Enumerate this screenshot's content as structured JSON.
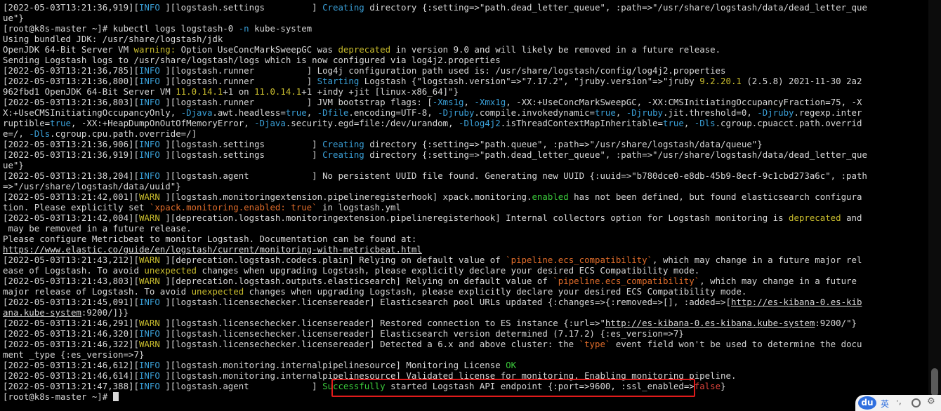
{
  "terminal": {
    "lines": [
      [
        {
          "t": "[2022-05-03T13:21:36,919]["
        },
        {
          "t": "INFO ",
          "c": "cyan"
        },
        {
          "t": "][logstash.settings         ] "
        },
        {
          "t": "Creating",
          "c": "cyan"
        },
        {
          "t": " directory {:setting=>\"path.dead_letter_queue\", :path=>\"/usr/share/logstash/data/dead_letter_que"
        }
      ],
      [
        {
          "t": "ue\"}"
        }
      ],
      [
        {
          "t": "[root@k8s-master ~]# kubectl logs logstash-0 "
        },
        {
          "t": "-n",
          "c": "cyan"
        },
        {
          "t": " kube-system"
        }
      ],
      [
        {
          "t": "Using bundled JDK: /usr/share/logstash/jdk"
        }
      ],
      [
        {
          "t": "OpenJDK 64-Bit Server VM "
        },
        {
          "t": "warning:",
          "c": "yellow"
        },
        {
          "t": " Option UseConcMarkSweepGC was "
        },
        {
          "t": "deprecated",
          "c": "yellow"
        },
        {
          "t": " in version 9.0 and will likely be removed in a future release."
        }
      ],
      [
        {
          "t": "Sending Logstash logs to /usr/share/logstash/logs which is now configured via log4j2.properties"
        }
      ],
      [
        {
          "t": "[2022-05-03T13:21:36,785]["
        },
        {
          "t": "INFO ",
          "c": "cyan"
        },
        {
          "t": "][logstash.runner          ] Log4j configuration path used is: /usr/share/logstash/config/log4j2.properties"
        }
      ],
      [
        {
          "t": "[2022-05-03T13:21:36,800]["
        },
        {
          "t": "INFO ",
          "c": "cyan"
        },
        {
          "t": "][logstash.runner          ] "
        },
        {
          "t": "Starting",
          "c": "cyan"
        },
        {
          "t": " Logstash {\"logstash.version\"=>\"7.17.2\", \"jruby.version\"=>\"jruby "
        },
        {
          "t": "9.2.20.1",
          "c": "yellow"
        },
        {
          "t": " (2.5.8) 2021-11-30 2a2"
        }
      ],
      [
        {
          "t": "962fbd1 OpenJDK 64-Bit Server VM "
        },
        {
          "t": "11.0.14.1",
          "c": "yellow"
        },
        {
          "t": "+1 on "
        },
        {
          "t": "11.0.14.1",
          "c": "yellow"
        },
        {
          "t": "+1 +indy +jit [linux-x86_64]\"}"
        }
      ],
      [
        {
          "t": "[2022-05-03T13:21:36,803]["
        },
        {
          "t": "INFO ",
          "c": "cyan"
        },
        {
          "t": "][logstash.runner          ] JVM bootstrap flags: ["
        },
        {
          "t": "-Xms1g",
          "c": "cyan"
        },
        {
          "t": ", "
        },
        {
          "t": "-Xmx1g",
          "c": "cyan"
        },
        {
          "t": ", -XX:+UseConcMarkSweepGC, -XX:CMSInitiatingOccupancyFraction=75, -X"
        }
      ],
      [
        {
          "t": "X:+UseCMSInitiatingOccupancyOnly, "
        },
        {
          "t": "-Djava",
          "c": "cyan"
        },
        {
          "t": ".awt.headless="
        },
        {
          "t": "true",
          "c": "cyan"
        },
        {
          "t": ", "
        },
        {
          "t": "-Dfile",
          "c": "cyan"
        },
        {
          "t": ".encoding=UTF-8, "
        },
        {
          "t": "-Djruby",
          "c": "cyan"
        },
        {
          "t": ".compile.invokedynamic="
        },
        {
          "t": "true",
          "c": "cyan"
        },
        {
          "t": ", "
        },
        {
          "t": "-Djruby",
          "c": "cyan"
        },
        {
          "t": ".jit.threshold=0, "
        },
        {
          "t": "-Djruby",
          "c": "cyan"
        },
        {
          "t": ".regexp.inter"
        }
      ],
      [
        {
          "t": "ruptible="
        },
        {
          "t": "true",
          "c": "cyan"
        },
        {
          "t": ", -XX:+HeapDumpOnOutOfMemoryError, "
        },
        {
          "t": "-Djava",
          "c": "cyan"
        },
        {
          "t": ".security.egd=file:/dev/urandom, "
        },
        {
          "t": "-Dlog4j2",
          "c": "cyan"
        },
        {
          "t": ".isThreadContextMapInheritable="
        },
        {
          "t": "true",
          "c": "cyan"
        },
        {
          "t": ", "
        },
        {
          "t": "-Dls",
          "c": "cyan"
        },
        {
          "t": ".cgroup.cpuacct.path.overrid"
        }
      ],
      [
        {
          "t": "e=/, "
        },
        {
          "t": "-Dls",
          "c": "cyan"
        },
        {
          "t": ".cgroup.cpu.path.override=/]"
        }
      ],
      [
        {
          "t": "[2022-05-03T13:21:36,906]["
        },
        {
          "t": "INFO ",
          "c": "cyan"
        },
        {
          "t": "][logstash.settings         ] "
        },
        {
          "t": "Creating",
          "c": "cyan"
        },
        {
          "t": " directory {:setting=>\"path.queue\", :path=>\"/usr/share/logstash/data/queue\"}"
        }
      ],
      [
        {
          "t": "[2022-05-03T13:21:36,919]["
        },
        {
          "t": "INFO ",
          "c": "cyan"
        },
        {
          "t": "][logstash.settings         ] "
        },
        {
          "t": "Creating",
          "c": "cyan"
        },
        {
          "t": " directory {:setting=>\"path.dead_letter_queue\", :path=>\"/usr/share/logstash/data/dead_letter_que"
        }
      ],
      [
        {
          "t": "ue\"}"
        }
      ],
      [
        {
          "t": "[2022-05-03T13:21:38,204]["
        },
        {
          "t": "INFO ",
          "c": "cyan"
        },
        {
          "t": "][logstash.agent            ] No persistent UUID file found. Generating new UUID {:uuid=>\"b780dce0-e8db-45b9-8ecf-9c1cbd273a6c\", :path"
        }
      ],
      [
        {
          "t": "=>\"/usr/share/logstash/data/uuid\"}"
        }
      ],
      [
        {
          "t": "[2022-05-03T13:21:42,001]["
        },
        {
          "t": "WARN ",
          "c": "yellow"
        },
        {
          "t": "][logstash.monitoringextension.pipelineregisterhook] xpack.monitoring."
        },
        {
          "t": "enabled",
          "c": "green"
        },
        {
          "t": " has not been defined, but found elasticsearch configura"
        }
      ],
      [
        {
          "t": "tion. Please explicitly set "
        },
        {
          "t": "`xpack.monitoring.enabled: true`",
          "c": "orange"
        },
        {
          "t": " in logstash.yml"
        }
      ],
      [
        {
          "t": "[2022-05-03T13:21:42,004]["
        },
        {
          "t": "WARN ",
          "c": "yellow"
        },
        {
          "t": "][deprecation.logstash.monitoringextension.pipelineregisterhook] Internal collectors option for Logstash monitoring is "
        },
        {
          "t": "deprecated",
          "c": "yellow"
        },
        {
          "t": " and"
        }
      ],
      [
        {
          "t": " may be removed in a future release."
        }
      ],
      [
        {
          "t": "Please configure Metricbeat to monitor Logstash. Documentation can be found at:"
        }
      ],
      [
        {
          "t": "https://www.elastic.co/guide/en/logstash/current/monitoring-with-metricbeat.html",
          "u": true
        }
      ],
      [
        {
          "t": "[2022-05-03T13:21:43,212]["
        },
        {
          "t": "WARN ",
          "c": "yellow"
        },
        {
          "t": "][deprecation.logstash.codecs.plain] Relying on default value of "
        },
        {
          "t": "`pipeline.ecs_compatibility`",
          "c": "orange"
        },
        {
          "t": ", which may change in a future major rel"
        }
      ],
      [
        {
          "t": "ease of Logstash. To avoid "
        },
        {
          "t": "unexpected",
          "c": "yellow"
        },
        {
          "t": " changes when upgrading Logstash, please explicitly declare your desired ECS Compatibility mode."
        }
      ],
      [
        {
          "t": "[2022-05-03T13:21:43,803]["
        },
        {
          "t": "WARN ",
          "c": "yellow"
        },
        {
          "t": "][deprecation.logstash.outputs.elasticsearch] Relying on default value of "
        },
        {
          "t": "`pipeline.ecs_compatibility`",
          "c": "orange"
        },
        {
          "t": ", which may change in a future"
        }
      ],
      [
        {
          "t": "major release of Logstash. To avoid "
        },
        {
          "t": "unexpected",
          "c": "yellow"
        },
        {
          "t": " changes when upgrading Logstash, please explicitly declare your desired ECS Compatibility mode."
        }
      ],
      [
        {
          "t": "[2022-05-03T13:21:45,091]["
        },
        {
          "t": "INFO ",
          "c": "cyan"
        },
        {
          "t": "][logstash.licensechecker.licensereader] Elasticsearch pool URLs updated {:changes=>{:removed=>[], :added=>["
        },
        {
          "t": "http://es-kibana-0.es-kib",
          "u": true
        }
      ],
      [
        {
          "t": "ana.kube-system",
          "u": true
        },
        {
          "t": ":9200/]}}"
        }
      ],
      [
        {
          "t": "[2022-05-03T13:21:46,291]["
        },
        {
          "t": "WARN ",
          "c": "yellow"
        },
        {
          "t": "][logstash.licensechecker.licensereader] Restored connection to ES instance {:url=>\""
        },
        {
          "t": "http://es-kibana-0.es-kibana.kube-system",
          "u": true
        },
        {
          "t": ":9200/\"}"
        }
      ],
      [
        {
          "t": "[2022-05-03T13:21:46,320]["
        },
        {
          "t": "INFO ",
          "c": "cyan"
        },
        {
          "t": "][logstash.licensechecker.licensereader] Elasticsearch version determined (7.17.2) {:es_version=>7}"
        }
      ],
      [
        {
          "t": "[2022-05-03T13:21:46,322]["
        },
        {
          "t": "WARN ",
          "c": "yellow"
        },
        {
          "t": "][logstash.licensechecker.licensereader] Detected a 6.x and above cluster: the "
        },
        {
          "t": "`type`",
          "c": "orange"
        },
        {
          "t": " event field won't be used to determine the docu"
        }
      ],
      [
        {
          "t": "ment _type {:es_version=>7}"
        }
      ],
      [
        {
          "t": "[2022-05-03T13:21:46,612]["
        },
        {
          "t": "INFO ",
          "c": "cyan"
        },
        {
          "t": "][logstash.monitoring.internalpipelinesource] Monitoring License "
        },
        {
          "t": "OK",
          "c": "green"
        }
      ],
      [
        {
          "t": "[2022-05-03T13:21:46,614]["
        },
        {
          "t": "INFO ",
          "c": "cyan"
        },
        {
          "t": "][logstash.monitoring.internalpipelinesource] Validated license for monitoring. Enabling monitoring pipeline."
        }
      ],
      [
        {
          "t": "[2022-05-03T13:21:47,388]["
        },
        {
          "t": "INFO ",
          "c": "cyan"
        },
        {
          "t": "][logstash.agent            ] "
        },
        {
          "t": "Successfully",
          "c": "green"
        },
        {
          "t": " started Logstash API endpoint {:port=>9600, :ssl_enabled=>"
        },
        {
          "t": "false",
          "c": "red"
        },
        {
          "t": "}"
        }
      ],
      [
        {
          "t": "[root@k8s-master ~]# "
        }
      ]
    ]
  },
  "ime": {
    "logo": "du",
    "lang": "英",
    "punct": "·,",
    "settings_glyph": "⚙"
  },
  "colors": {
    "background": "#000000",
    "text": "#d8d8d8",
    "cyan": "#3aa0d8",
    "green": "#3bc93b",
    "yellow": "#c9bd2e",
    "orange": "#e06c2a",
    "red": "#e0443c",
    "highlight_box": "#e01b1b"
  }
}
